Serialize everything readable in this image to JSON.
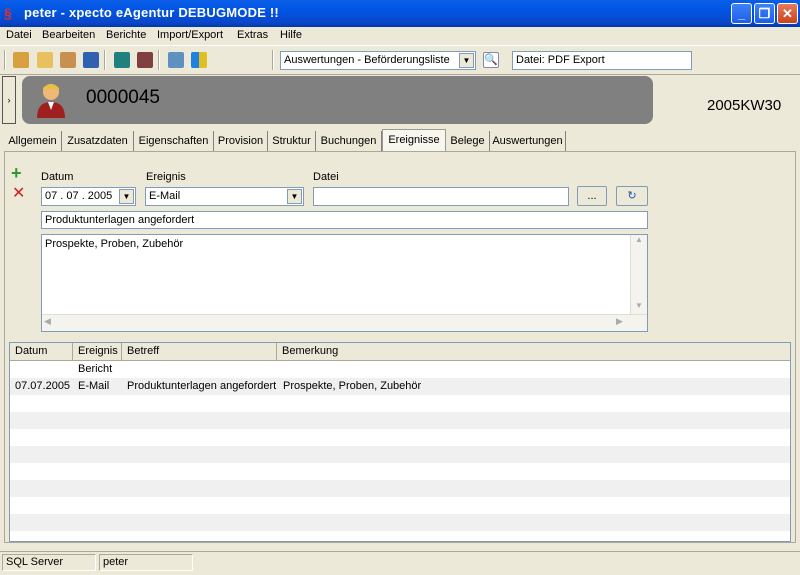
{
  "window": {
    "title": "peter - xpecto eAgentur    DEBUGMODE !!",
    "icon": "app-icon",
    "controls": [
      "minimize-icon",
      "maximize-icon",
      "close-icon"
    ]
  },
  "menu": [
    "Datei",
    "Bearbeiten",
    "Berichte",
    "Import/Export",
    "Extras",
    "Hilfe"
  ],
  "toolbar": {
    "report_select": "Auswertungen - Beförderungsliste",
    "export_field": "Datei: PDF Export",
    "week": "2005KW30"
  },
  "record": {
    "number": "0000045",
    "avatar": "user-avatar-icon"
  },
  "tabs": [
    "Allgemein",
    "Zusatzdaten",
    "Eigenschaften",
    "Provision",
    "Struktur",
    "Buchungen",
    "Ereignisse",
    "Belege",
    "Auswertungen"
  ],
  "active_tab": "Ereignisse",
  "form": {
    "datum_label": "Datum",
    "ereignis_label": "Ereignis",
    "datei_label": "Datei",
    "datum_value": "07 . 07 . 2005",
    "ereignis_value": "E-Mail",
    "datei_value": "",
    "browse_label": "...",
    "betreff": "Produktunterlagen angefordert",
    "bemerkung": "Prospekte, Proben, Zubehör"
  },
  "grid": {
    "columns": [
      "Datum",
      "Ereignis",
      "Betreff",
      "Bemerkung"
    ],
    "subheader": "Bericht",
    "rows": [
      {
        "datum": "07.07.2005",
        "ereignis": "E-Mail",
        "betreff": "Produktunterlagen angefordert",
        "bemerkung": "Prospekte, Proben, Zubehör"
      }
    ]
  },
  "status": {
    "server": "SQL Server",
    "user": "peter"
  },
  "colors": {
    "titlebar": "#0054e3",
    "header_bg": "#808080",
    "add": "#2a9a2a",
    "delete": "#d02020"
  }
}
